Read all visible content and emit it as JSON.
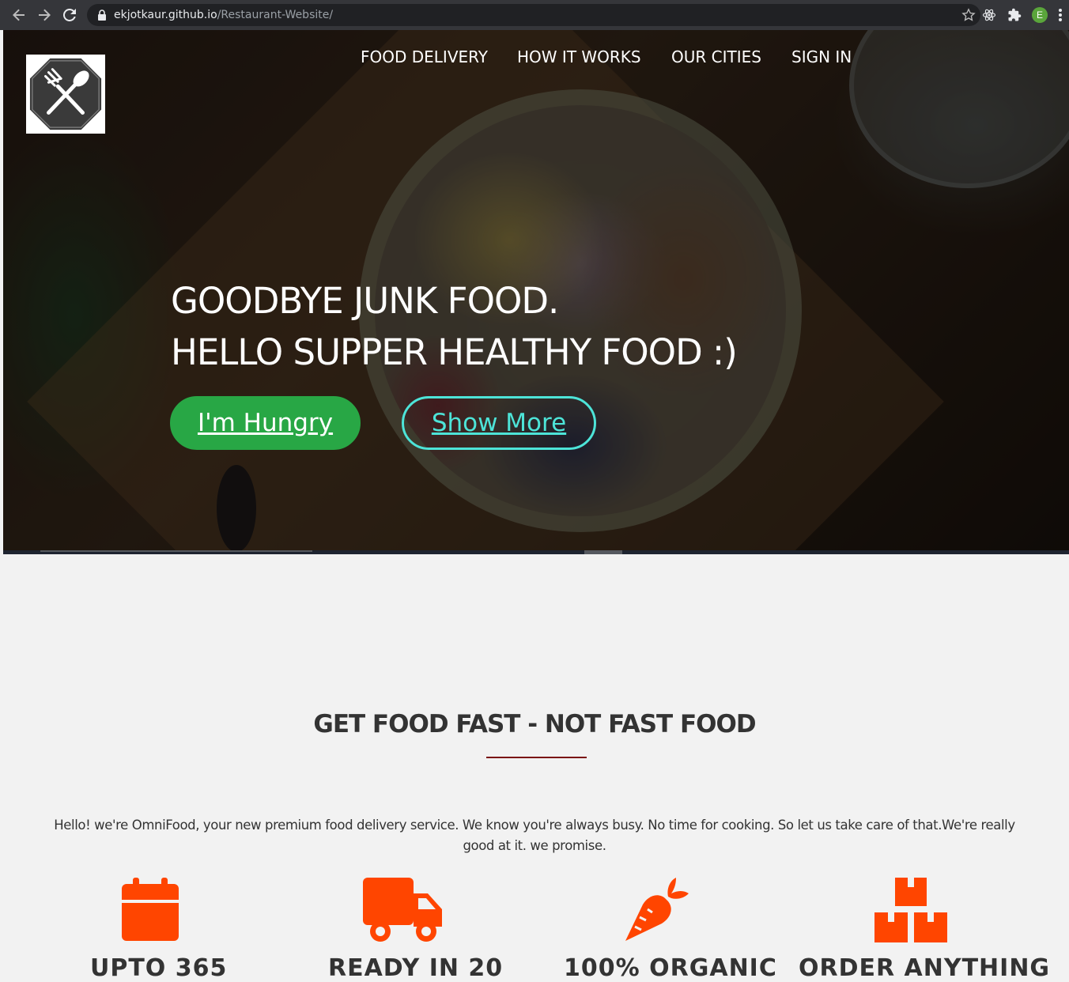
{
  "browser": {
    "url_host": "ekjotkaur.github.io",
    "url_path": "/Restaurant-Website/",
    "profile_initial": "E"
  },
  "nav": {
    "items": [
      {
        "label": "FOOD DELIVERY"
      },
      {
        "label": "HOW IT WORKS"
      },
      {
        "label": "OUR CITIES"
      },
      {
        "label": "SIGN IN"
      }
    ]
  },
  "hero": {
    "line1": "GOODBYE JUNK FOOD.",
    "line2": "HELLO SUPPER HEALTHY FOOD :)",
    "primary_button": "I'm Hungry",
    "secondary_button": "Show More"
  },
  "features": {
    "title": "GET FOOD FAST - NOT FAST FOOD",
    "intro": "Hello! we're OmniFood, your new premium food delivery service. We know you're always busy. No time for cooking. So let us take care of that.We're really good at it. we promise.",
    "items": [
      {
        "icon": "calendar-icon",
        "heading": "UPTO 365"
      },
      {
        "icon": "truck-icon",
        "heading": "READY IN 20"
      },
      {
        "icon": "carrot-icon",
        "heading": "100% ORGANIC"
      },
      {
        "icon": "boxes-icon",
        "heading": "ORDER ANYTHING"
      }
    ],
    "accent_color": "#ff4500"
  }
}
